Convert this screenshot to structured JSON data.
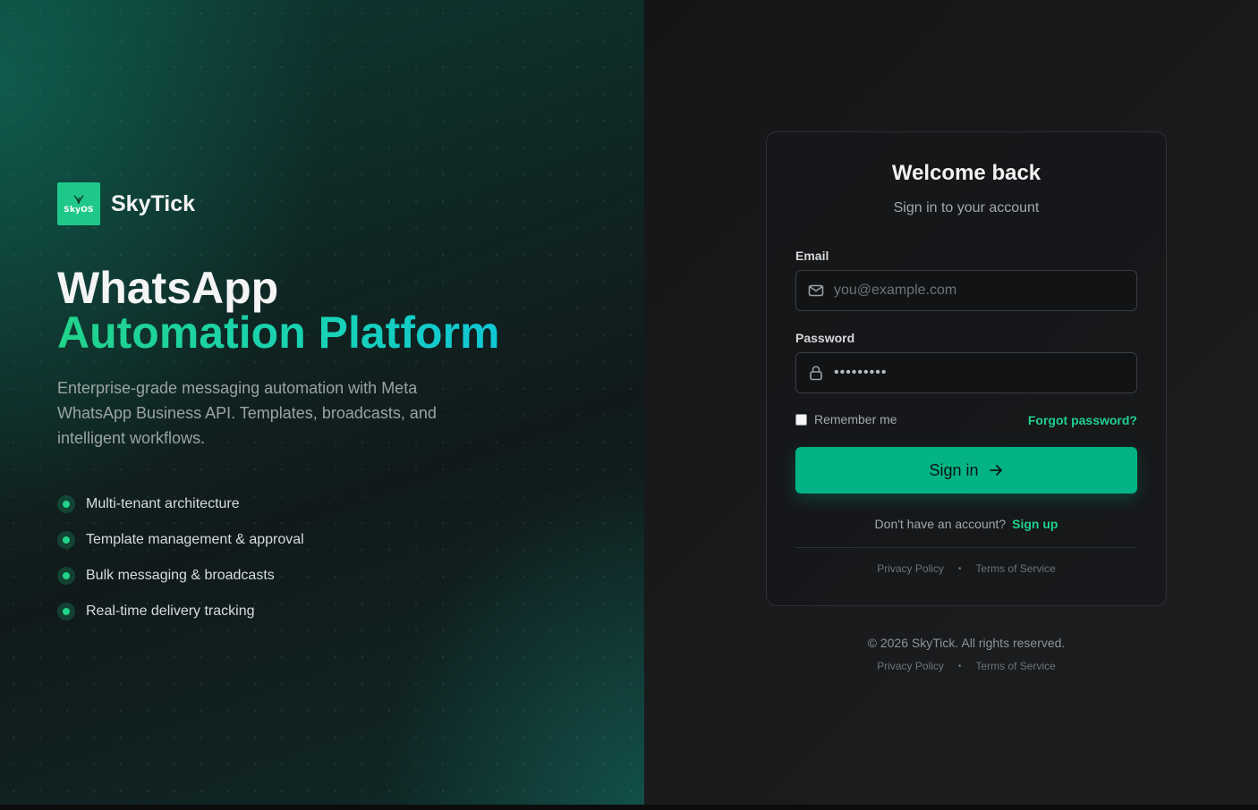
{
  "brand": {
    "name": "SkyTick",
    "logo_text": "SkyOS",
    "logo_color": "#1fc88a"
  },
  "hero": {
    "headline_line1": "WhatsApp",
    "headline_line2": "Automation Platform",
    "description": "Enterprise-grade messaging automation with Meta WhatsApp Business API. Templates, broadcasts, and intelligent workflows.",
    "features": [
      "Multi-tenant architecture",
      "Template management & approval",
      "Bulk messaging & broadcasts",
      "Real-time delivery tracking"
    ]
  },
  "login": {
    "title": "Welcome back",
    "subtitle": "Sign in to your account",
    "email_label": "Email",
    "email_placeholder": "you@example.com",
    "password_label": "Password",
    "password_value": "•••••••••",
    "remember_label": "Remember me",
    "forgot_label": "Forgot password?",
    "signin_label": "Sign in",
    "signup_prompt": "Don't have an account?",
    "signup_link": "Sign up",
    "privacy": "Privacy Policy",
    "terms": "Terms of Service"
  },
  "footer": {
    "copyright": "© 2026 SkyTick. All rights reserved.",
    "privacy": "Privacy Policy",
    "terms": "Terms of Service"
  },
  "colors": {
    "accent": "#03b386",
    "accent_text": "#21d08d",
    "background": "#161718"
  },
  "icons": [
    "mail-icon",
    "lock-icon",
    "arrow-right-icon",
    "leaf-icon",
    "bullet-dot-icon"
  ]
}
